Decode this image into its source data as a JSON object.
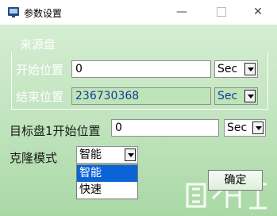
{
  "window": {
    "title": "参数设置"
  },
  "source_group": {
    "title": "来源盘",
    "start_label": "开始位置",
    "start_value": "0",
    "start_unit": "Sec",
    "end_label": "结束位置",
    "end_value": "236730368",
    "end_unit": "Sec"
  },
  "target": {
    "label": "目标盘1开始位置",
    "value": "0",
    "unit": "Sec"
  },
  "clone_mode": {
    "label": "克隆模式",
    "selected": "智能",
    "options": [
      "智能",
      "快速"
    ]
  },
  "buttons": {
    "ok": "确定"
  },
  "colors": {
    "accent": "#0a64d6",
    "panel_green": "#bfe3bc",
    "readonly_field": "#bde5b8"
  }
}
